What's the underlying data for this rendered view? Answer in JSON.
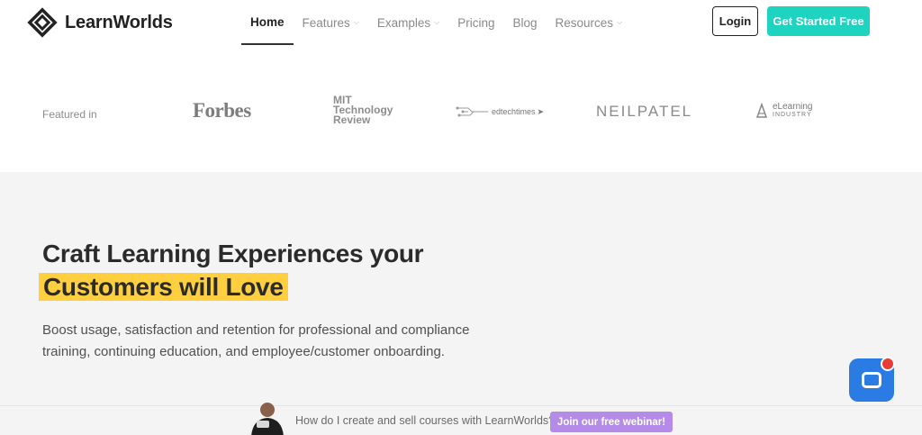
{
  "header": {
    "brand": "LearnWorlds",
    "nav": [
      {
        "label": "Home"
      },
      {
        "label": "Features"
      },
      {
        "label": "Examples"
      },
      {
        "label": "Pricing"
      },
      {
        "label": "Blog"
      },
      {
        "label": "Resources"
      }
    ],
    "login_label": "Login",
    "cta_label": "Get Started Free"
  },
  "featured": {
    "label": "Featured in",
    "press": {
      "forbes": "Forbes",
      "mit_line1": "MIT",
      "mit_line2": "Technology",
      "mit_line3": "Review",
      "edtech": "edtechtimes",
      "neil": "NEILPATEL",
      "elearning_line1": "eLearning",
      "elearning_line2": "INDUSTRY"
    }
  },
  "hero": {
    "title_line1": "Craft Learning Experiences your",
    "title_highlight": "Customers will Love",
    "subtitle": "Boost usage, satisfaction and retention for professional and compliance training, continuing education, and employee/customer onboarding."
  },
  "banner": {
    "text": "How do I create and sell courses with LearnWorlds?",
    "button_label": "Join our free webinar!"
  },
  "colors": {
    "accent_teal": "#1ed3c0",
    "highlight_yellow": "#ffcf40",
    "chat_blue": "#2a7be4",
    "webinar_purple": "#b48be8",
    "badge_red": "#e83b36"
  },
  "icons": {
    "logo": "learnworlds-diamond-logo",
    "chat": "chat-bubble-icon",
    "dropdown": "chevron-down-icon"
  }
}
